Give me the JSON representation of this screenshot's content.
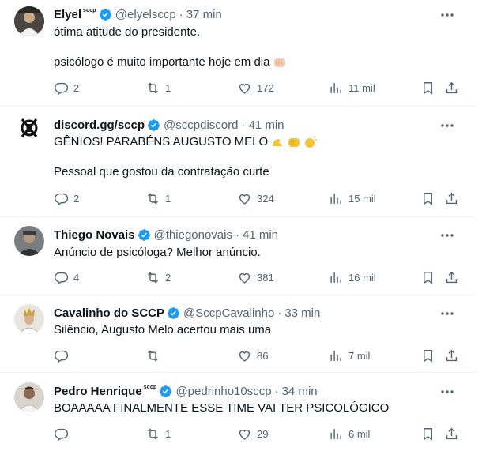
{
  "tweets": [
    {
      "name": "Elyel",
      "affiliation": "sccp",
      "handle": "@elyelsccp",
      "time": "37 min",
      "lines": [
        "ótima atitude do presidente.",
        "psicólogo é muito importante hoje em dia"
      ],
      "emojis": [
        "fist-emoji"
      ],
      "replies": "2",
      "retweets": "1",
      "likes": "172",
      "views": "11 mil"
    },
    {
      "name": "discord.gg/sccp",
      "affiliation": "",
      "handle": "@sccpdiscord",
      "time": "41 min",
      "lines": [
        "GÊNIOS! PARABÉNS AUGUSTO MELO",
        "Pessoal que gostou da contratação curte"
      ],
      "emojis": [
        "flexed-biceps-emoji",
        "fist-emoji",
        "clapping-hands-emoji"
      ],
      "replies": "2",
      "retweets": "1",
      "likes": "324",
      "views": "15 mil"
    },
    {
      "name": "Thiego Novais",
      "affiliation": "",
      "handle": "@thiegonovais",
      "time": "41 min",
      "lines": [
        "Anúncio de psicóloga? Melhor anúncio."
      ],
      "replies": "4",
      "retweets": "2",
      "likes": "381",
      "views": "16 mil"
    },
    {
      "name": "Cavalinho do SCCP",
      "affiliation": "",
      "handle": "@SccpCavalinho",
      "time": "33 min",
      "lines": [
        "Silêncio, Augusto Melo acertou mais uma"
      ],
      "replies": "",
      "retweets": "",
      "likes": "86",
      "views": "7 mil"
    },
    {
      "name": "Pedro Henrique",
      "affiliation": "sccp",
      "handle": "@pedrinho10sccp",
      "time": "34 min",
      "lines": [
        "BOAAAAA FINALMENTE ESSE TIME VAI TER PSICOLÓGICO"
      ],
      "replies": "",
      "retweets": "1",
      "likes": "29",
      "views": "6 mil"
    }
  ],
  "colors": {
    "verified": "#1d9bf0",
    "muted": "#536471",
    "text": "#0f1419",
    "divider": "#eff3f4"
  }
}
